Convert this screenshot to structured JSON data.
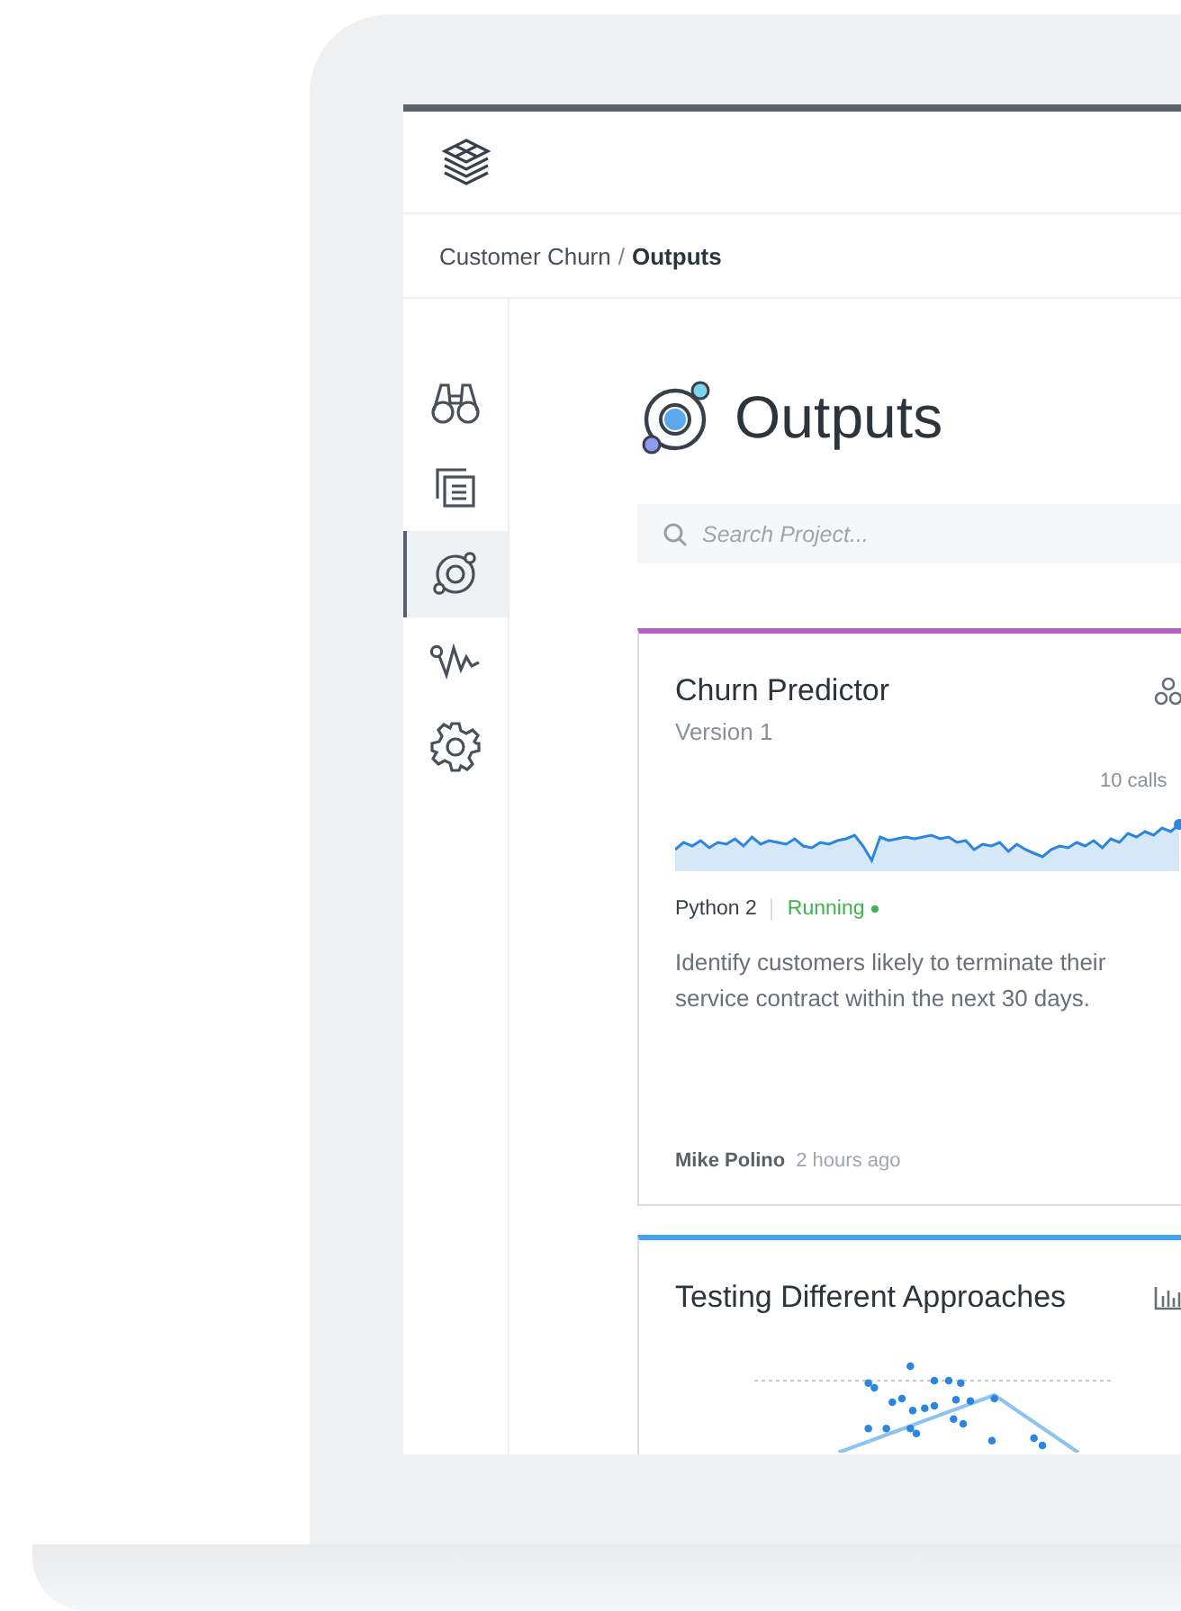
{
  "breadcrumb": {
    "parent": "Customer Churn",
    "separator": "/",
    "current": "Outputs"
  },
  "sidebar": {
    "items": [
      {
        "selected": false
      },
      {
        "selected": false
      },
      {
        "selected": true
      },
      {
        "selected": false
      },
      {
        "selected": false
      }
    ]
  },
  "page_title": "Outputs",
  "search": {
    "placeholder": "Search Project..."
  },
  "cards": [
    {
      "kind": "model",
      "color": "#b65fc4",
      "title": "Churn Predictor",
      "version": "Version 1",
      "calls": "10 calls",
      "runtime": "Python 2",
      "status": "Running",
      "healthy": true,
      "description": "Identify customers likely to terminate their service contract within the next 30 days.",
      "author": "Mike Polino",
      "time": "2 hours ago"
    },
    {
      "kind": "experiment",
      "color": "#4aa0ea",
      "title": "Testing Different Approaches"
    }
  ]
}
